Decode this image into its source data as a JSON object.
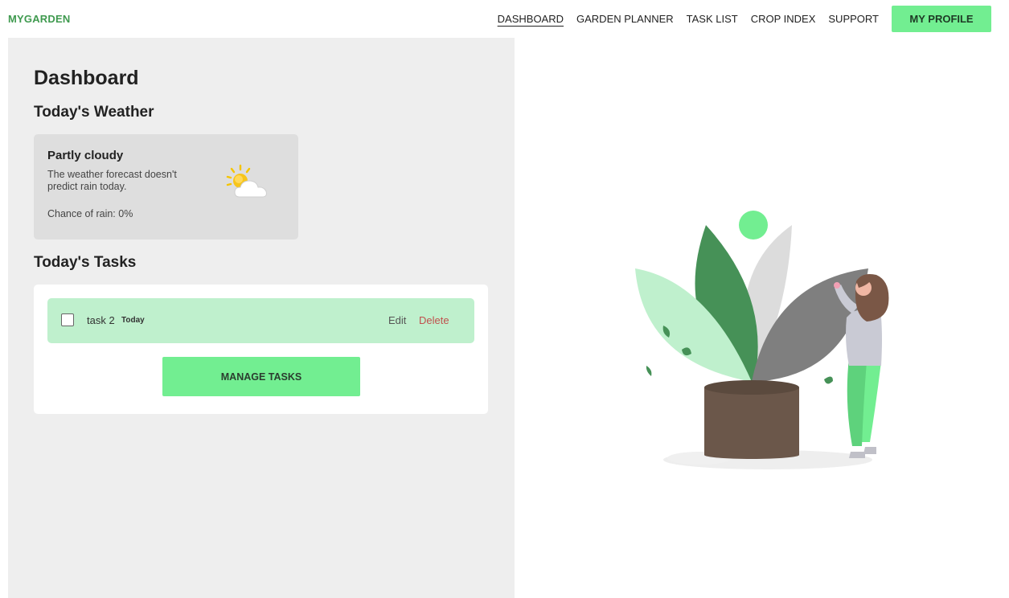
{
  "app": {
    "logo": "MYGARDEN"
  },
  "nav": {
    "items": [
      {
        "label": "DASHBOARD",
        "active": true
      },
      {
        "label": "GARDEN PLANNER"
      },
      {
        "label": "TASK LIST"
      },
      {
        "label": "CROP INDEX"
      },
      {
        "label": "SUPPORT"
      }
    ],
    "profile_label": "MY PROFILE"
  },
  "dashboard": {
    "title": "Dashboard",
    "weather_heading": "Today's Weather",
    "tasks_heading": "Today's Tasks"
  },
  "weather": {
    "condition": "Partly cloudy",
    "description": "The weather forecast doesn't predict rain today.",
    "rain_chance": "Chance of rain: 0%",
    "icon": "partly-cloudy-icon"
  },
  "tasks": {
    "items": [
      {
        "name": "task 2",
        "due": "Today",
        "checked": false,
        "edit_label": "Edit",
        "delete_label": "Delete"
      }
    ],
    "manage_label": "MANAGE TASKS"
  },
  "colors": {
    "accent": "#72ee91",
    "logo": "#3f9a4f",
    "task_row": "#bff0cd",
    "delete": "#c0504d",
    "panel": "#eeeeee"
  }
}
